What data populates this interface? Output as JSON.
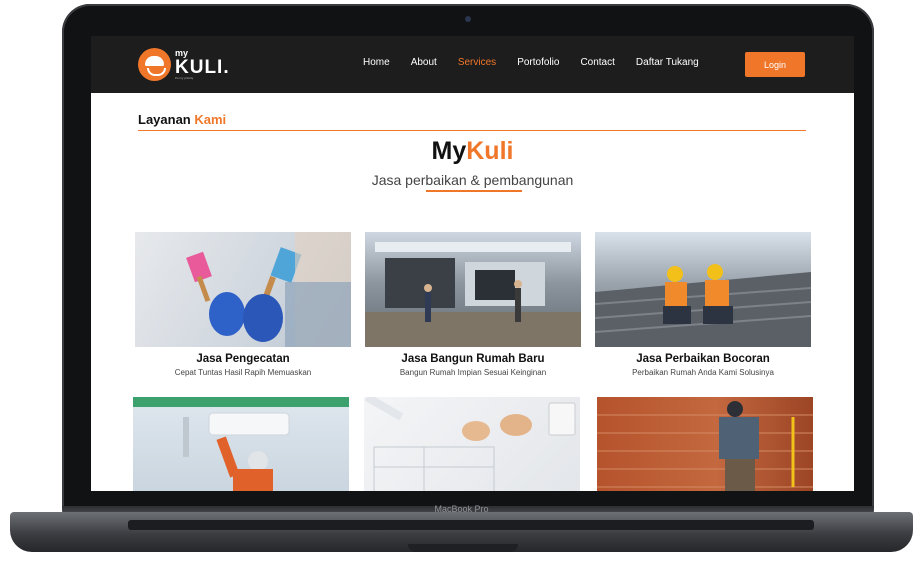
{
  "device": {
    "label": "MacBook Pro"
  },
  "nav": {
    "logo": {
      "small": "my",
      "big": "KULI.",
      "tagline": "it's my priority"
    },
    "items": [
      {
        "label": "Home",
        "active": false
      },
      {
        "label": "About",
        "active": false
      },
      {
        "label": "Services",
        "active": true
      },
      {
        "label": "Portofolio",
        "active": false
      },
      {
        "label": "Contact",
        "active": false
      },
      {
        "label": "Daftar Tukang",
        "active": false
      }
    ],
    "login_label": "Login"
  },
  "section": {
    "title_main": "Layanan ",
    "title_accent": "Kami",
    "brand_main": "My",
    "brand_accent": "Kuli",
    "tagline": "Jasa perbaikan & pembangunan"
  },
  "services": [
    {
      "title": "Jasa Pengecatan",
      "subtitle": "Cepat Tuntas Hasil Rapih Memuaskan",
      "icon": "paint-brush-photo"
    },
    {
      "title": "Jasa Bangun Rumah Baru",
      "subtitle": "Bangun Rumah Impian Sesuai Keinginan",
      "icon": "house-construction-photo"
    },
    {
      "title": "Jasa Perbaikan Bocoran",
      "subtitle": "Perbaikan Rumah Anda Kami Solusinya",
      "icon": "roof-repair-photo"
    },
    {
      "title": "",
      "subtitle": "",
      "icon": "ac-repair-photo"
    },
    {
      "title": "",
      "subtitle": "",
      "icon": "blueprint-photo"
    },
    {
      "title": "",
      "subtitle": "",
      "icon": "brick-wall-photo"
    }
  ],
  "colors": {
    "accent": "#f0772a",
    "nav_bg": "#1d1d1d",
    "bezel": "#111214"
  }
}
